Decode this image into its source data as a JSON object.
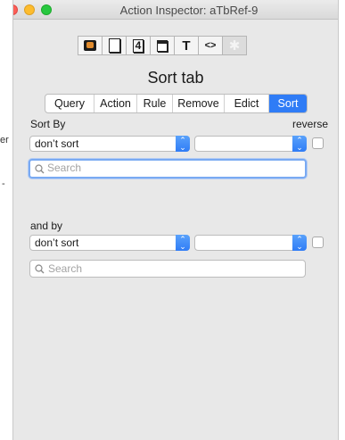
{
  "background_text": {
    "t1": "er",
    "t2": "-"
  },
  "window": {
    "title": "Action Inspector: aTbRef-9"
  },
  "toolbar": {
    "buttons": [
      {
        "name": "general-tab-icon",
        "glyph": ""
      },
      {
        "name": "text-tab-icon",
        "glyph": ""
      },
      {
        "name": "data-tab-icon",
        "glyph": "4"
      },
      {
        "name": "appearance-tab-icon",
        "glyph": ""
      },
      {
        "name": "text-style-icon",
        "glyph": "T"
      },
      {
        "name": "code-icon",
        "glyph": "<>"
      },
      {
        "name": "action-gear-icon",
        "glyph": "✱"
      }
    ]
  },
  "heading": "Sort tab",
  "tabs": [
    {
      "label": "Query",
      "active": false
    },
    {
      "label": "Action",
      "active": false
    },
    {
      "label": "Rule",
      "active": false
    },
    {
      "label": "Remove",
      "active": false
    },
    {
      "label": "Edict",
      "active": false
    },
    {
      "label": "Sort",
      "active": true
    }
  ],
  "sort_by": {
    "label": "Sort By",
    "reverse_label": "reverse",
    "attribute_value": "don’t sort",
    "second_value": "",
    "search_placeholder": "Search"
  },
  "and_by": {
    "label": "and by",
    "attribute_value": "don’t sort",
    "second_value": "",
    "search_placeholder": "Search"
  },
  "colors": {
    "accent": "#2f7cf6",
    "focus_ring": "#7aaaf2"
  }
}
